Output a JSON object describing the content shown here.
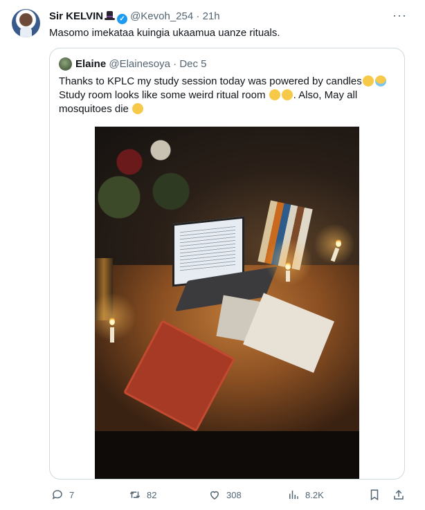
{
  "tweet": {
    "author_name": "Sir KELVIN",
    "handle": "@Kevoh_254",
    "time": "21h",
    "separator": "·",
    "text": "Masomo imekataa kuingia ukaamua uanze rituals."
  },
  "quote": {
    "author_name": "Elaine",
    "handle": "@Elainesoya",
    "date": "Dec 5",
    "separator": "·",
    "text_line1": "Thanks to KPLC my study session today was powered by candles",
    "text_line2a": "Study room looks like some weird ritual room",
    "text_line2b": ". Also, May all",
    "text_line3": "mosquitoes die",
    "photo_alt": "Candle-lit desk with laptop, books and papers"
  },
  "actions": {
    "replies": "7",
    "retweets": "82",
    "likes": "308",
    "views": "8.2K"
  },
  "colors": {
    "muted": "#536471",
    "verified": "#1d9bf0",
    "border": "#cfd9de"
  },
  "icons": {
    "more": "more-icon",
    "reply": "reply-icon",
    "retweet": "retweet-icon",
    "like": "heart-icon",
    "views": "views-icon",
    "bookmark": "bookmark-icon",
    "share": "share-icon"
  }
}
